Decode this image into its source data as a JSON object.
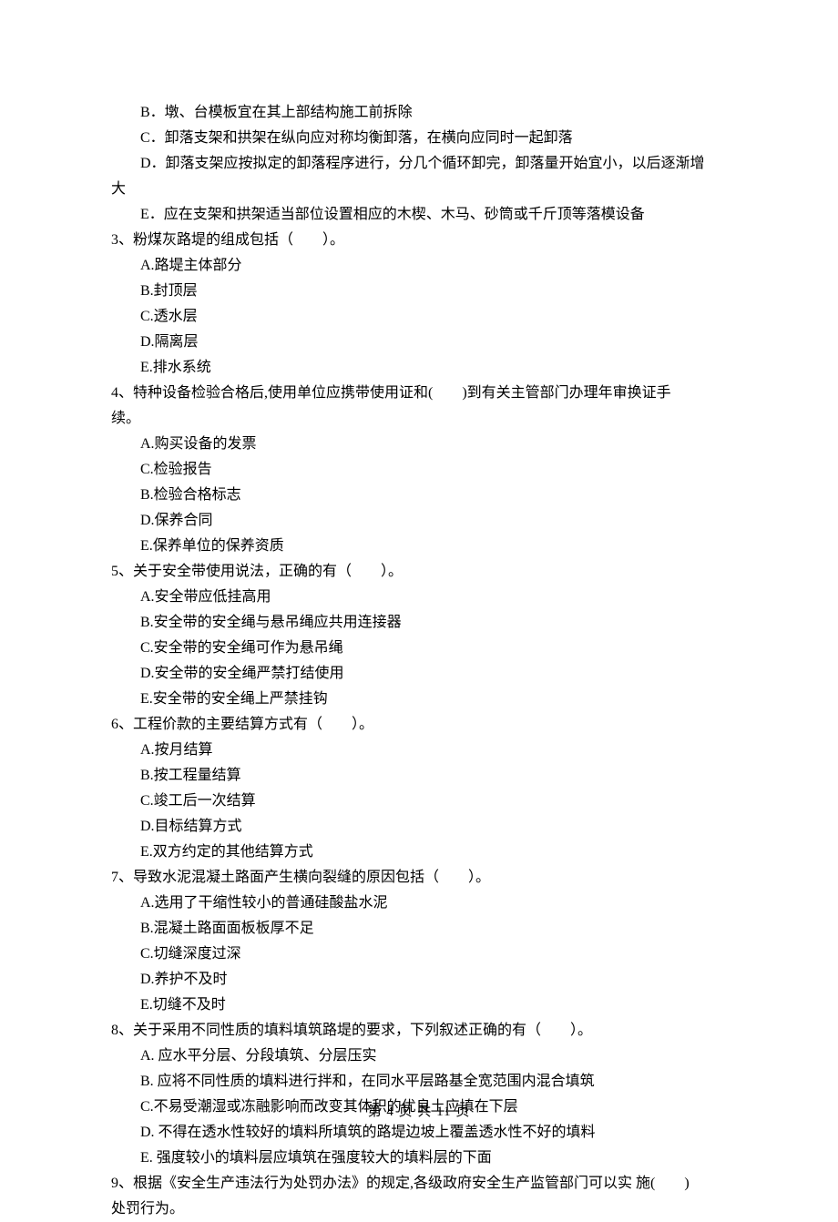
{
  "lines": [
    {
      "text": "B．墩、台模板宜在其上部结构施工前拆除",
      "indent": 1
    },
    {
      "text": "C．卸落支架和拱架在纵向应对称均衡卸落，在横向应同时一起卸落",
      "indent": 1
    },
    {
      "text": "D．卸落支架应按拟定的卸落程序进行，分几个循环卸完，卸落量开始宜小，以后逐渐增",
      "indent": 1
    },
    {
      "text": "大",
      "indent": 0
    },
    {
      "text": "E．应在支架和拱架适当部位设置相应的木楔、木马、砂筒或千斤顶等落模设备",
      "indent": 1
    },
    {
      "text": "3、粉煤灰路堤的组成包括（　　）。",
      "indent": 0
    },
    {
      "text": "A.路堤主体部分",
      "indent": 1
    },
    {
      "text": "B.封顶层",
      "indent": 1
    },
    {
      "text": "C.透水层",
      "indent": 1
    },
    {
      "text": "D.隔离层",
      "indent": 1
    },
    {
      "text": "E.排水系统",
      "indent": 1
    },
    {
      "text": "4、特种设备检验合格后,使用单位应携带使用证和(　　)到有关主管部门办理年审换证手",
      "indent": 0
    },
    {
      "text": "续。",
      "indent": 0
    },
    {
      "text": "A.购买设备的发票",
      "indent": 1
    },
    {
      "text": "C.检验报告",
      "indent": 1
    },
    {
      "text": "B.检验合格标志",
      "indent": 1
    },
    {
      "text": "D.保养合同",
      "indent": 1
    },
    {
      "text": "E.保养单位的保养资质",
      "indent": 1
    },
    {
      "text": "5、关于安全带使用说法，正确的有（　　）。",
      "indent": 0
    },
    {
      "text": "A.安全带应低挂高用",
      "indent": 1
    },
    {
      "text": "B.安全带的安全绳与悬吊绳应共用连接器",
      "indent": 1
    },
    {
      "text": "C.安全带的安全绳可作为悬吊绳",
      "indent": 1
    },
    {
      "text": "D.安全带的安全绳严禁打结使用",
      "indent": 1
    },
    {
      "text": "E.安全带的安全绳上严禁挂钩",
      "indent": 1
    },
    {
      "text": "6、工程价款的主要结算方式有（　　）。",
      "indent": 0
    },
    {
      "text": "A.按月结算",
      "indent": 1
    },
    {
      "text": "B.按工程量结算",
      "indent": 1
    },
    {
      "text": "C.竣工后一次结算",
      "indent": 1
    },
    {
      "text": "D.目标结算方式",
      "indent": 1
    },
    {
      "text": "E.双方约定的其他结算方式",
      "indent": 1
    },
    {
      "text": "7、导致水泥混凝土路面产生横向裂缝的原因包括（　　）。",
      "indent": 0
    },
    {
      "text": "A.选用了干缩性较小的普通硅酸盐水泥",
      "indent": 1
    },
    {
      "text": "B.混凝土路面面板板厚不足",
      "indent": 1
    },
    {
      "text": "C.切缝深度过深",
      "indent": 1
    },
    {
      "text": "D.养护不及时",
      "indent": 1
    },
    {
      "text": "E.切缝不及时",
      "indent": 1
    },
    {
      "text": "8、关于采用不同性质的填料填筑路堤的要求，下列叙述正确的有（　　）。",
      "indent": 0
    },
    {
      "text": "A. 应水平分层、分段填筑、分层压实",
      "indent": 1
    },
    {
      "text": "B. 应将不同性质的填料进行拌和，在同水平层路基全宽范围内混合填筑",
      "indent": 1
    },
    {
      "text": "C.不易受潮湿或冻融影响而改变其体积的优良土应填在下层",
      "indent": 1
    },
    {
      "text": "D. 不得在透水性较好的填料所填筑的路堤边坡上覆盖透水性不好的填料",
      "indent": 1
    },
    {
      "text": "E. 强度较小的填料层应填筑在强度较大的填料层的下面",
      "indent": 1
    },
    {
      "text": "9、根据《安全生产违法行为处罚办法》的规定,各级政府安全生产监管部门可以实 施(　　)",
      "indent": 0
    },
    {
      "text": "处罚行为。",
      "indent": 0
    }
  ],
  "footer": "第 4 页 共 11 页"
}
